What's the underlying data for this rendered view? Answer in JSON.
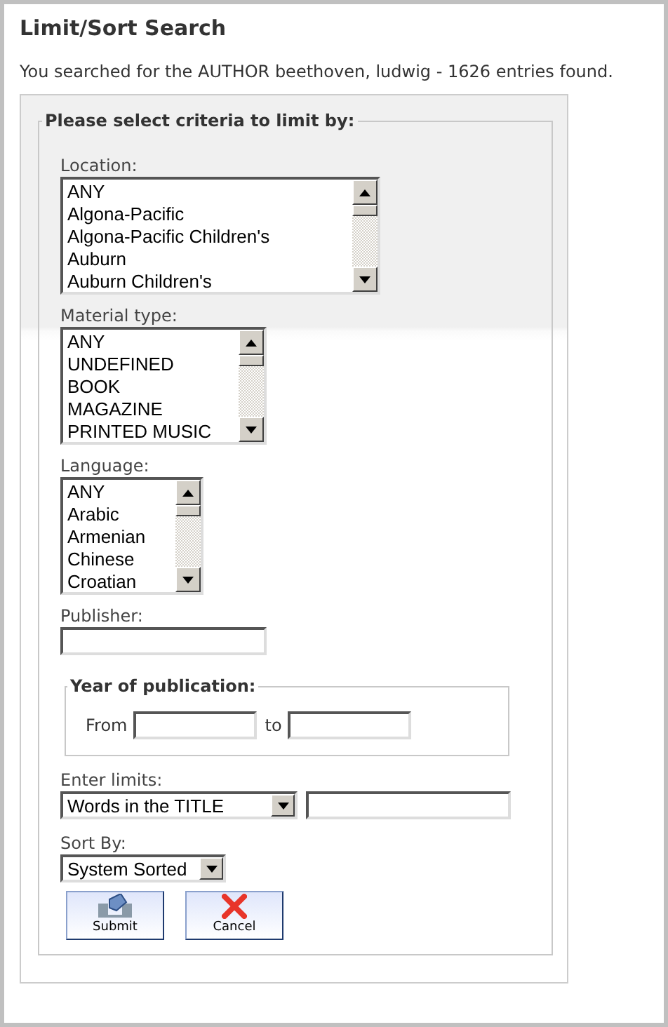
{
  "title": "Limit/Sort Search",
  "summary": "You searched for the AUTHOR beethoven, ludwig - 1626 entries found.",
  "criteria": {
    "legend": "Please select criteria to limit by:",
    "lists": [
      {
        "label": "Location:",
        "options": [
          "ANY",
          "Algona-Pacific",
          "Algona-Pacific Children's",
          "Auburn",
          "Auburn Children's"
        ]
      },
      {
        "label": "Material type:",
        "options": [
          "ANY",
          "UNDEFINED",
          "BOOK",
          "MAGAZINE",
          "PRINTED MUSIC"
        ]
      },
      {
        "label": "Language:",
        "options": [
          "ANY",
          "Arabic",
          "Armenian",
          "Chinese",
          "Croatian"
        ]
      }
    ],
    "publisher": {
      "label": "Publisher:"
    },
    "year": {
      "legend": "Year of publication:",
      "from_label": "From",
      "to_label": "to"
    },
    "limits": {
      "label": "Enter limits:",
      "value": "Words in the TITLE"
    },
    "sort": {
      "label": "Sort By:",
      "value": "System Sorted"
    },
    "buttons": [
      {
        "label": "Submit",
        "kind": "submit"
      },
      {
        "label": "Cancel",
        "kind": "cancel"
      }
    ]
  }
}
